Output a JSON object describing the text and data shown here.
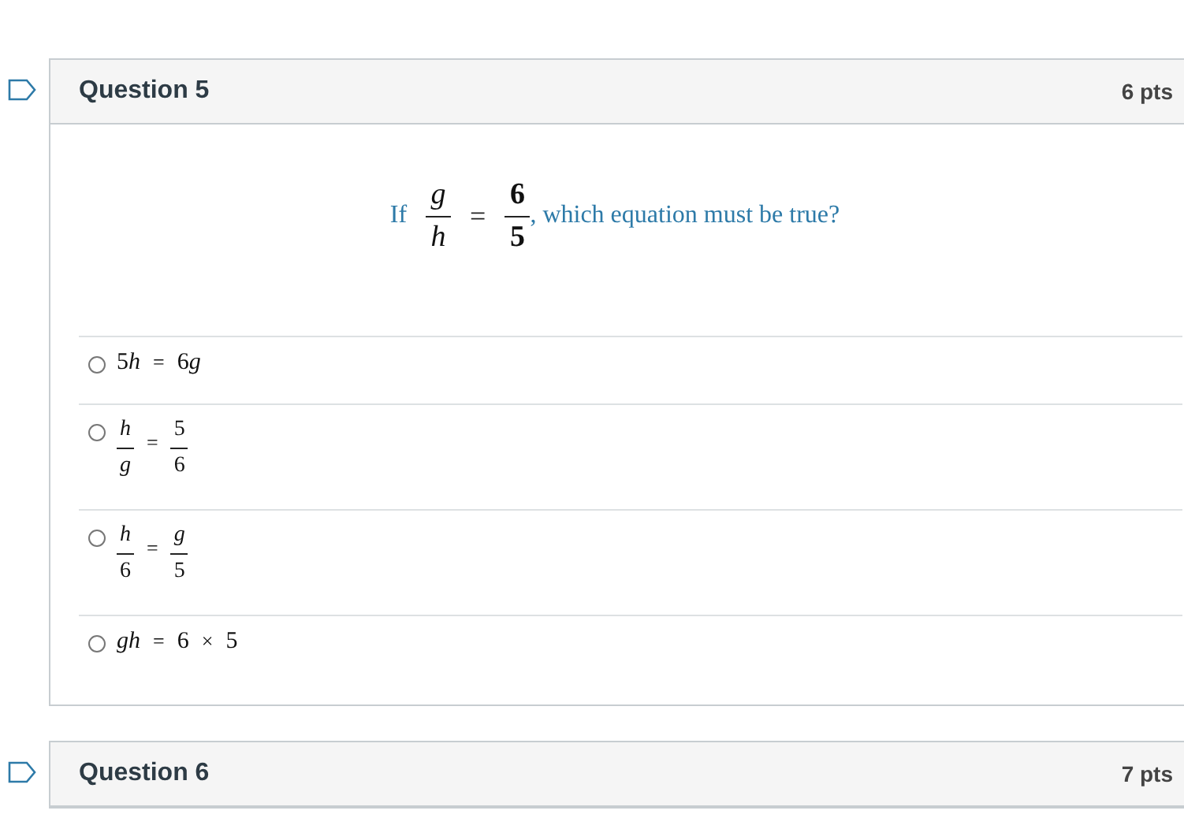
{
  "questions": [
    {
      "title": "Question 5",
      "points": "6 pts",
      "prompt": {
        "before": "If",
        "left": {
          "num": "*g*",
          "den": "*h*"
        },
        "operator": "=",
        "right": {
          "num": "6",
          "den": "5"
        },
        "after": ", which equation must be true?"
      },
      "answers": [
        {
          "kind": "inline",
          "parts": [
            {
              "kind": "num",
              "text": "5"
            },
            {
              "kind": "var",
              "text": "h"
            },
            {
              "kind": "op",
              "text": "="
            },
            {
              "kind": "num",
              "text": "6"
            },
            {
              "kind": "var",
              "text": "g"
            }
          ],
          "selected": false
        },
        {
          "kind": "fraction",
          "left": {
            "num": "*h*",
            "den": "*g*"
          },
          "operator": "=",
          "right": {
            "num": "5",
            "den": "6"
          },
          "selected": false
        },
        {
          "kind": "fraction",
          "left": {
            "num": "*h*",
            "den": "6"
          },
          "operator": "=",
          "right": {
            "num": "*g*",
            "den": "5"
          },
          "selected": false
        },
        {
          "kind": "inline",
          "parts": [
            {
              "kind": "var",
              "text": "gh"
            },
            {
              "kind": "op",
              "text": "="
            },
            {
              "kind": "num",
              "text": "6"
            },
            {
              "kind": "op",
              "text": "×"
            },
            {
              "kind": "num",
              "text": "5"
            }
          ],
          "selected": false
        }
      ]
    },
    {
      "title": "Question 6",
      "points": "7 pts"
    }
  ]
}
